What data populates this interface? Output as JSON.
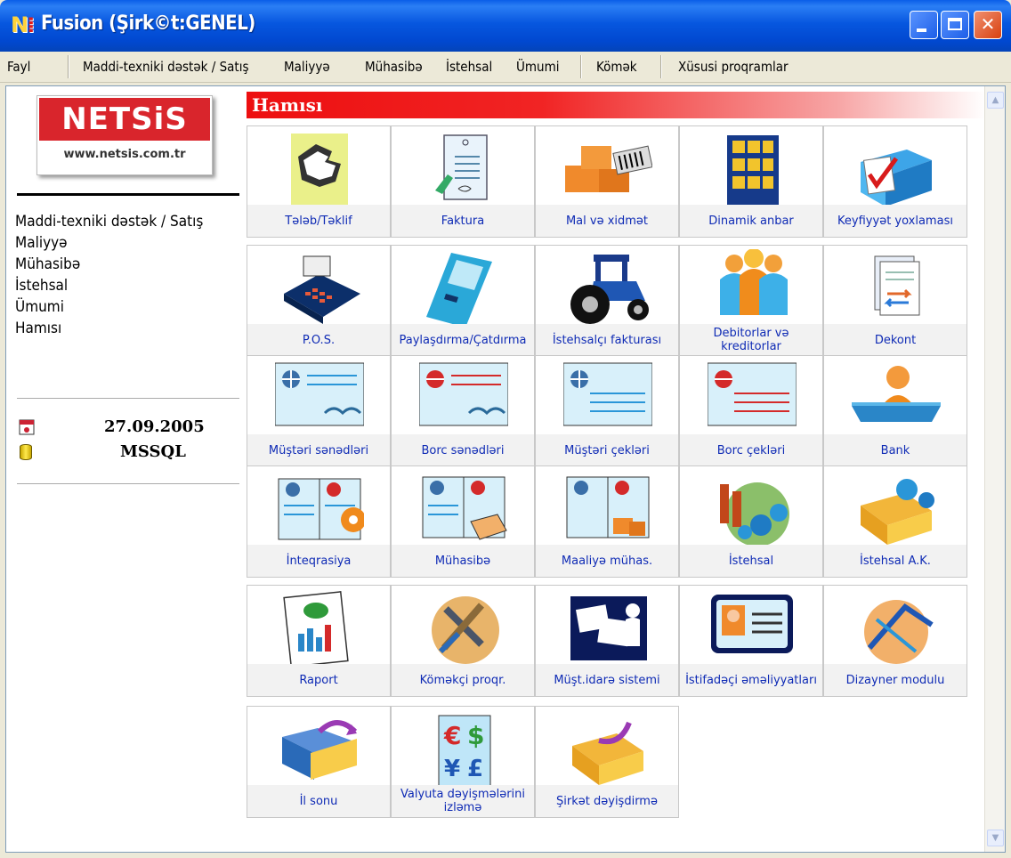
{
  "window": {
    "logo_text": "N",
    "title": "Fusion (Şirk©t:GENEL)"
  },
  "menu": {
    "items": [
      "Fayl",
      "Maddi-texniki dəstək / Satış",
      "Maliyyə",
      "Mühasibə",
      "İstehsal",
      "Ümumi",
      "Kömək",
      "Xüsusi proqramlar"
    ]
  },
  "sidebar": {
    "brand": "NETSiS",
    "url": "www.netsis.com.tr",
    "nav": [
      "Maddi-texniki dəstək / Satış",
      "Maliyyə",
      "Mühasibə",
      "İstehsal",
      "Ümumi",
      "Hamısı"
    ],
    "date": "27.09.2005",
    "database": "MSSQL"
  },
  "section": {
    "title": "Hamısı"
  },
  "tiles": [
    {
      "label": "Tələb/Təklif",
      "icon": "hands-icon"
    },
    {
      "label": "Faktura",
      "icon": "invoice-icon"
    },
    {
      "label": "Mal və xidmət",
      "icon": "boxes-barcode-icon"
    },
    {
      "label": "Dinamik anbar",
      "icon": "warehouse-shelf-icon"
    },
    {
      "label": "Keyfiyyət yoxlaması",
      "icon": "quality-check-icon"
    },
    {
      "label": "P.O.S.",
      "icon": "pos-terminal-icon"
    },
    {
      "label": "Paylaşdırma/Çatdırma",
      "icon": "handheld-device-icon"
    },
    {
      "label": "İstehsalçı fakturası",
      "icon": "tractor-icon"
    },
    {
      "label": "Debitorlar və kreditorlar",
      "icon": "people-icon"
    },
    {
      "label": "Dekont",
      "icon": "document-arrows-icon"
    },
    {
      "label": "Müştəri sənədləri",
      "icon": "customer-docs-icon"
    },
    {
      "label": "Borc sənədləri",
      "icon": "debt-docs-icon"
    },
    {
      "label": "Müştəri çekləri",
      "icon": "customer-cheque-icon"
    },
    {
      "label": "Borc çekləri",
      "icon": "debt-cheque-icon"
    },
    {
      "label": "Bank",
      "icon": "bank-person-icon"
    },
    {
      "label": "İnteqrasiya",
      "icon": "book-gear-icon"
    },
    {
      "label": "Mühasibə",
      "icon": "book-calculator-icon"
    },
    {
      "label": "Maaliyə mühas.",
      "icon": "book-boxes-icon"
    },
    {
      "label": "İstehsal",
      "icon": "factory-gears-icon"
    },
    {
      "label": "İstehsal A.K.",
      "icon": "folder-gears-icon"
    },
    {
      "label": "Raport",
      "icon": "report-chart-icon"
    },
    {
      "label": "Köməkçi proqr.",
      "icon": "tools-icon"
    },
    {
      "label": "Müşt.idarə sistemi",
      "icon": "crm-icon"
    },
    {
      "label": "İstifadəçi əməliyyatları",
      "icon": "user-card-icon"
    },
    {
      "label": "Dizayner modulu",
      "icon": "designer-icon"
    },
    {
      "label": "İl sonu",
      "icon": "folder-arrow-icon"
    },
    {
      "label": "Valyuta dəyişmələrini izləmə",
      "icon": "currency-icon"
    },
    {
      "label": "Şirkət dəyişdirmə",
      "icon": "folder-switch-icon"
    }
  ]
}
